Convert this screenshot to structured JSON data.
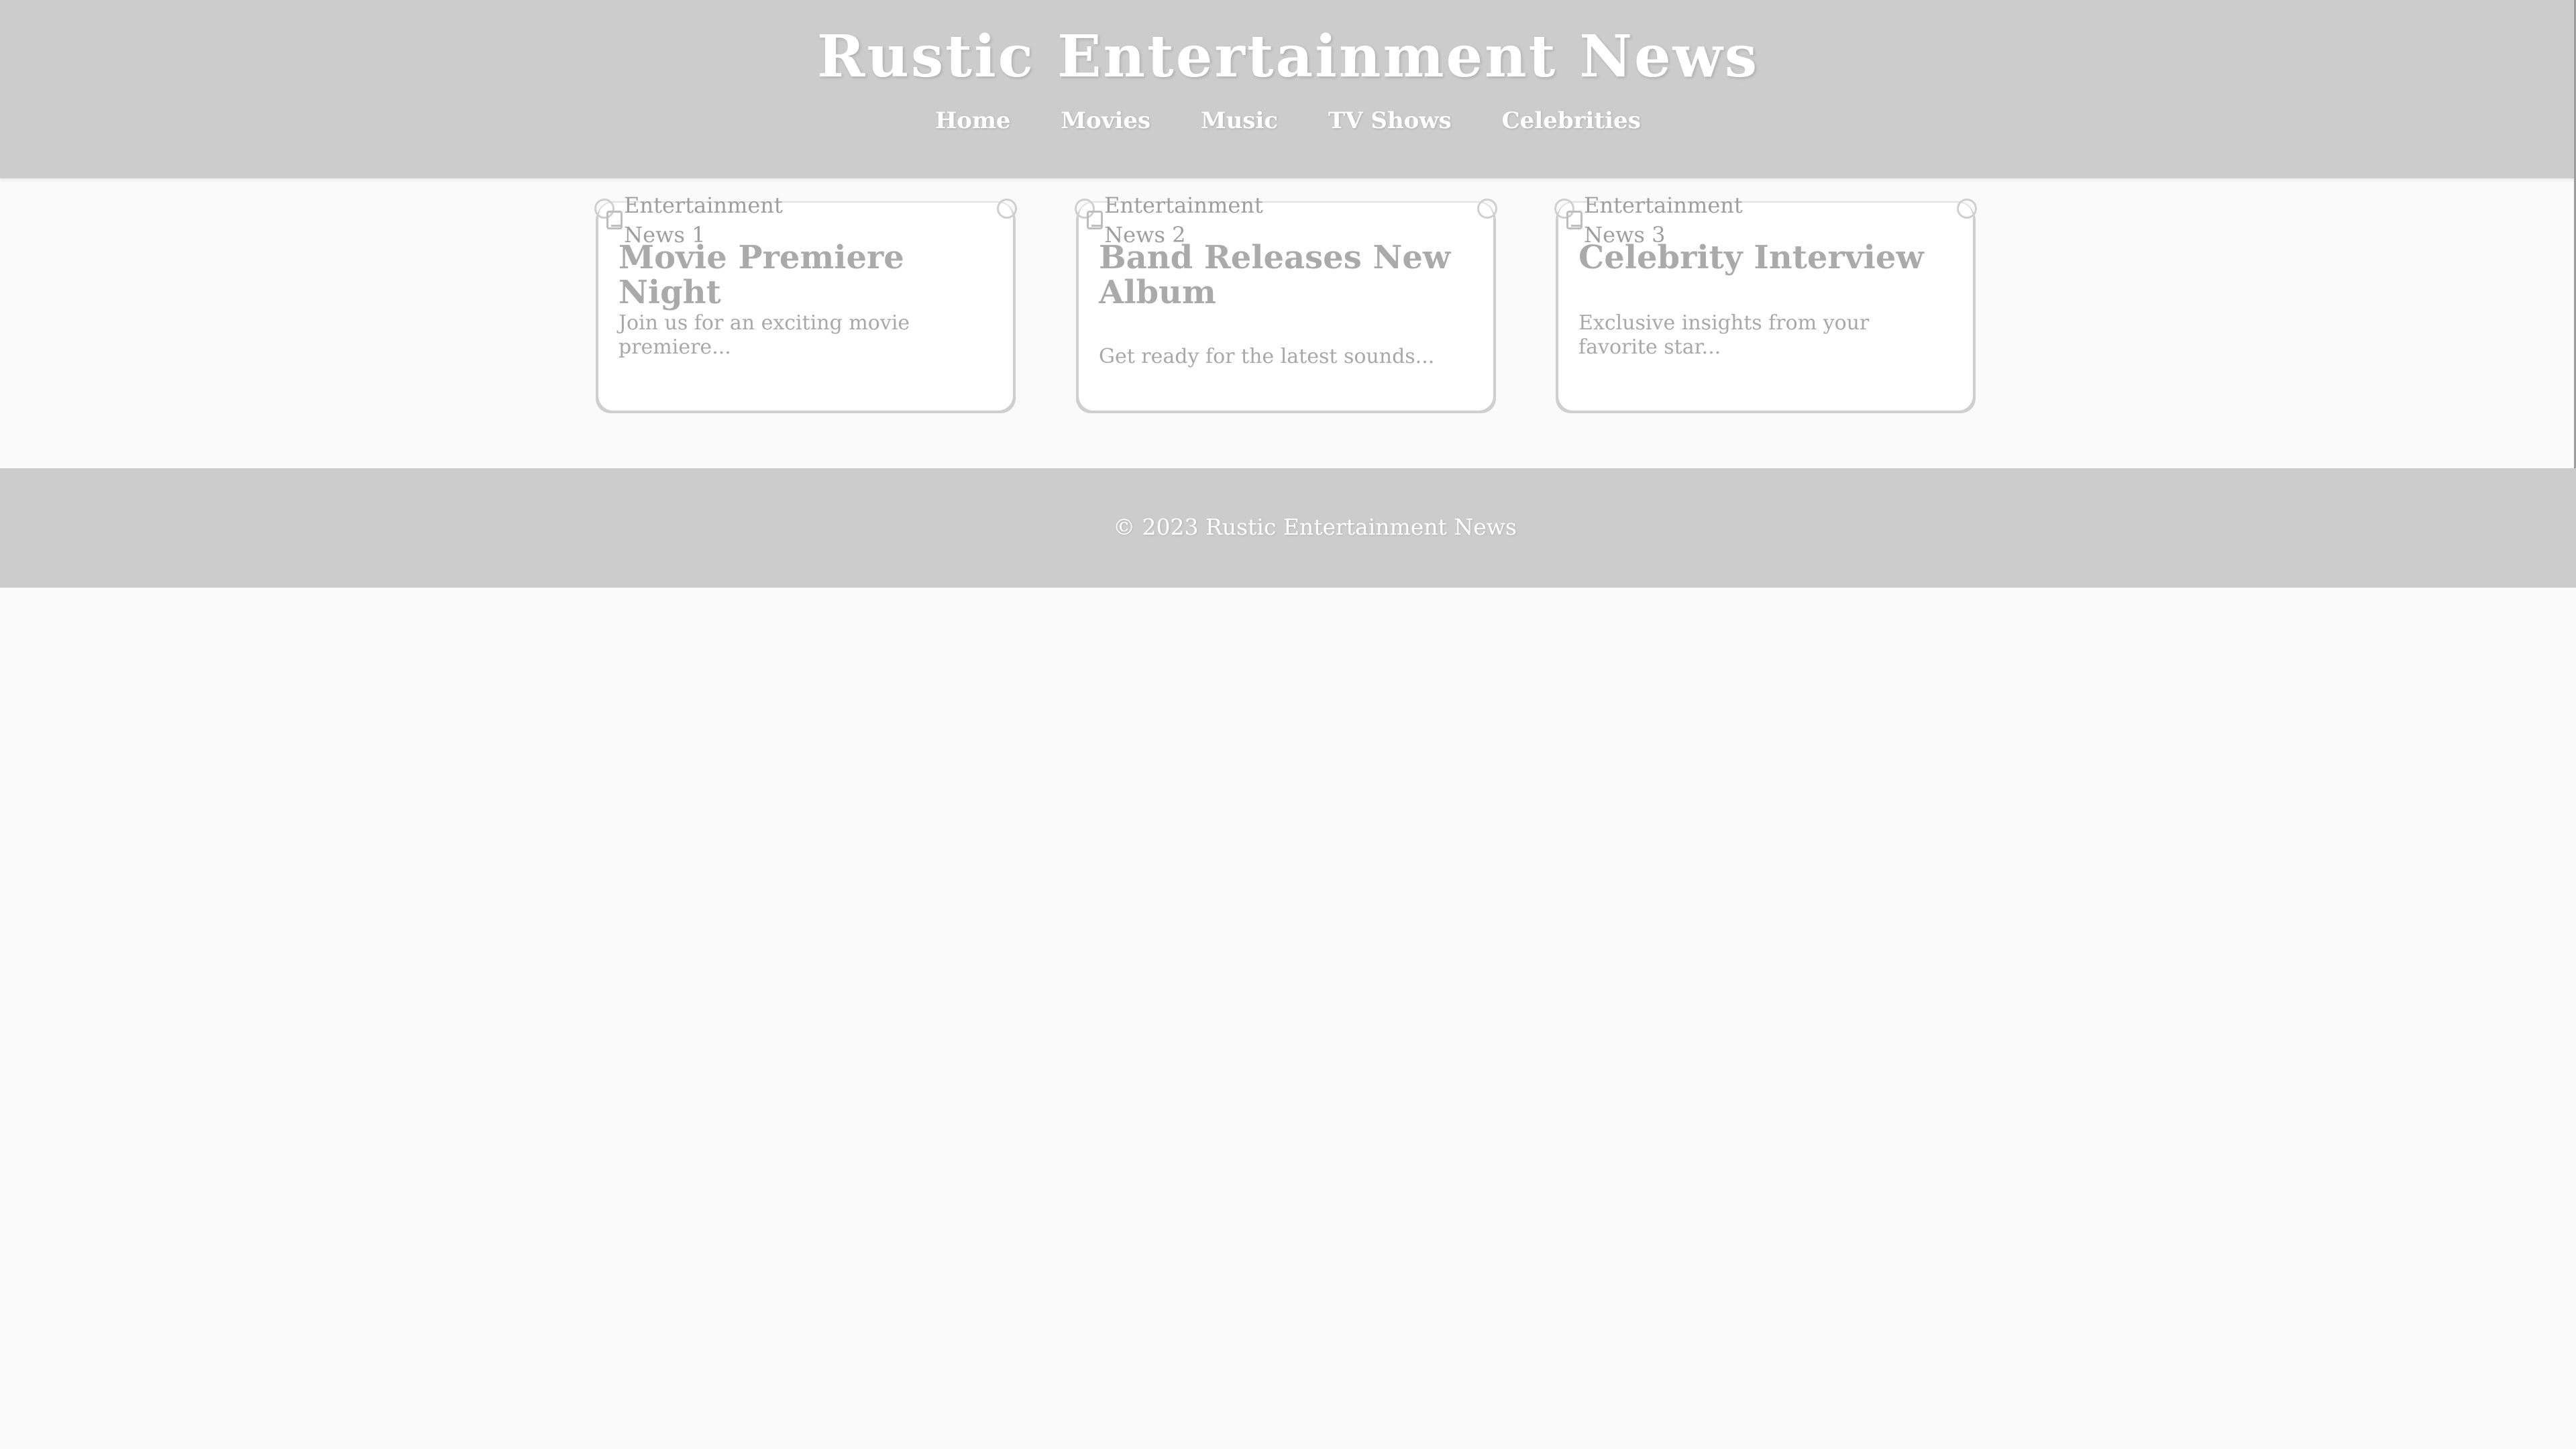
{
  "header": {
    "title": "Rustic Entertainment News",
    "nav": [
      "Home",
      "Movies",
      "Music",
      "TV Shows",
      "Celebrities"
    ]
  },
  "cards": [
    {
      "image_alt": "Entertainment News 1",
      "title": "Movie Premiere Night",
      "description": "Join us for an exciting movie premiere..."
    },
    {
      "image_alt": "Entertainment News 2",
      "title": "Band Releases New Album",
      "description": "Get ready for the latest sounds..."
    },
    {
      "image_alt": "Entertainment News 3",
      "title": "Celebrity Interview",
      "description": "Exclusive insights from your favorite star..."
    }
  ],
  "footer": {
    "text": "© 2023 Rustic Entertainment News"
  },
  "colors": {
    "header_bg": "#cccccc",
    "page_bg": "#fafafa",
    "card_bg": "#ffffff",
    "text_muted": "#aaaaaa"
  }
}
